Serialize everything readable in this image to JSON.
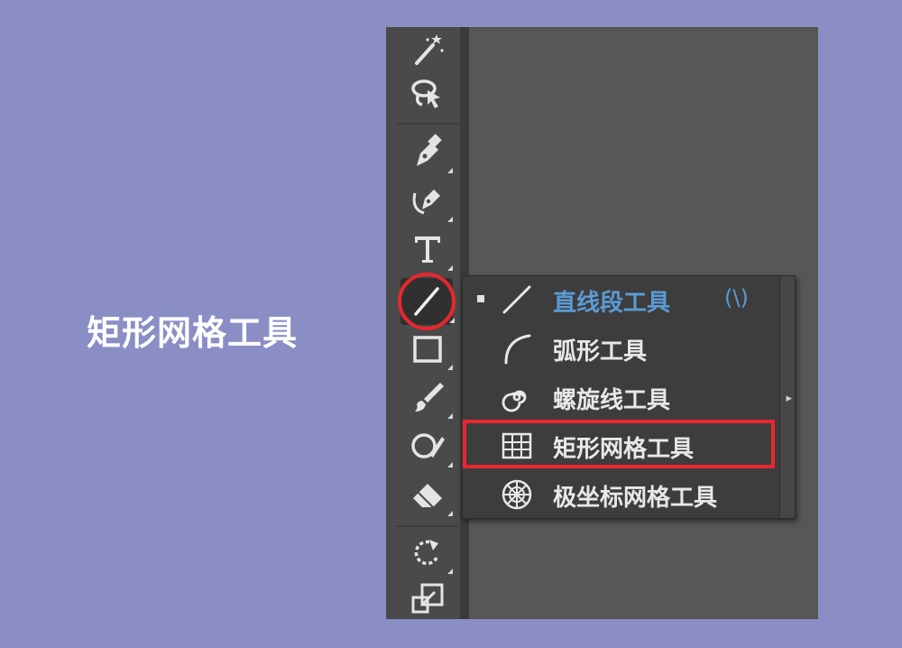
{
  "caption": "矩形网格工具",
  "colors": {
    "background": "#8a8ec5",
    "panel": "#575757",
    "toolbar": "#4a4a4a",
    "flyout": "#3d3d3d",
    "highlight": "#e8282e",
    "selected_text": "#5b9bd5"
  },
  "toolbar": {
    "tools": [
      {
        "name": "magic-wand-tool",
        "icon": "magic-wand-icon"
      },
      {
        "name": "lasso-tool",
        "icon": "lasso-icon"
      },
      {
        "name": "pen-tool",
        "icon": "pen-icon"
      },
      {
        "name": "curvature-tool",
        "icon": "curvature-pen-icon"
      },
      {
        "name": "type-tool",
        "icon": "type-icon",
        "glyph": "T"
      },
      {
        "name": "line-segment-tool",
        "icon": "line-segment-icon",
        "active": true
      },
      {
        "name": "rectangle-tool",
        "icon": "rectangle-icon"
      },
      {
        "name": "paintbrush-tool",
        "icon": "paintbrush-icon"
      },
      {
        "name": "shaper-tool",
        "icon": "shaper-icon"
      },
      {
        "name": "eraser-tool",
        "icon": "eraser-icon"
      },
      {
        "name": "rotate-tool",
        "icon": "rotate-icon"
      },
      {
        "name": "scale-tool",
        "icon": "scale-icon"
      }
    ]
  },
  "flyout": {
    "items": [
      {
        "label": "直线段工具",
        "shortcut": "(\\)",
        "icon": "line-segment-icon",
        "selected": true
      },
      {
        "label": "弧形工具",
        "icon": "arc-icon"
      },
      {
        "label": "螺旋线工具",
        "icon": "spiral-icon"
      },
      {
        "label": "矩形网格工具",
        "icon": "rectangular-grid-icon",
        "highlighted": true
      },
      {
        "label": "极坐标网格工具",
        "icon": "polar-grid-icon"
      }
    ]
  }
}
